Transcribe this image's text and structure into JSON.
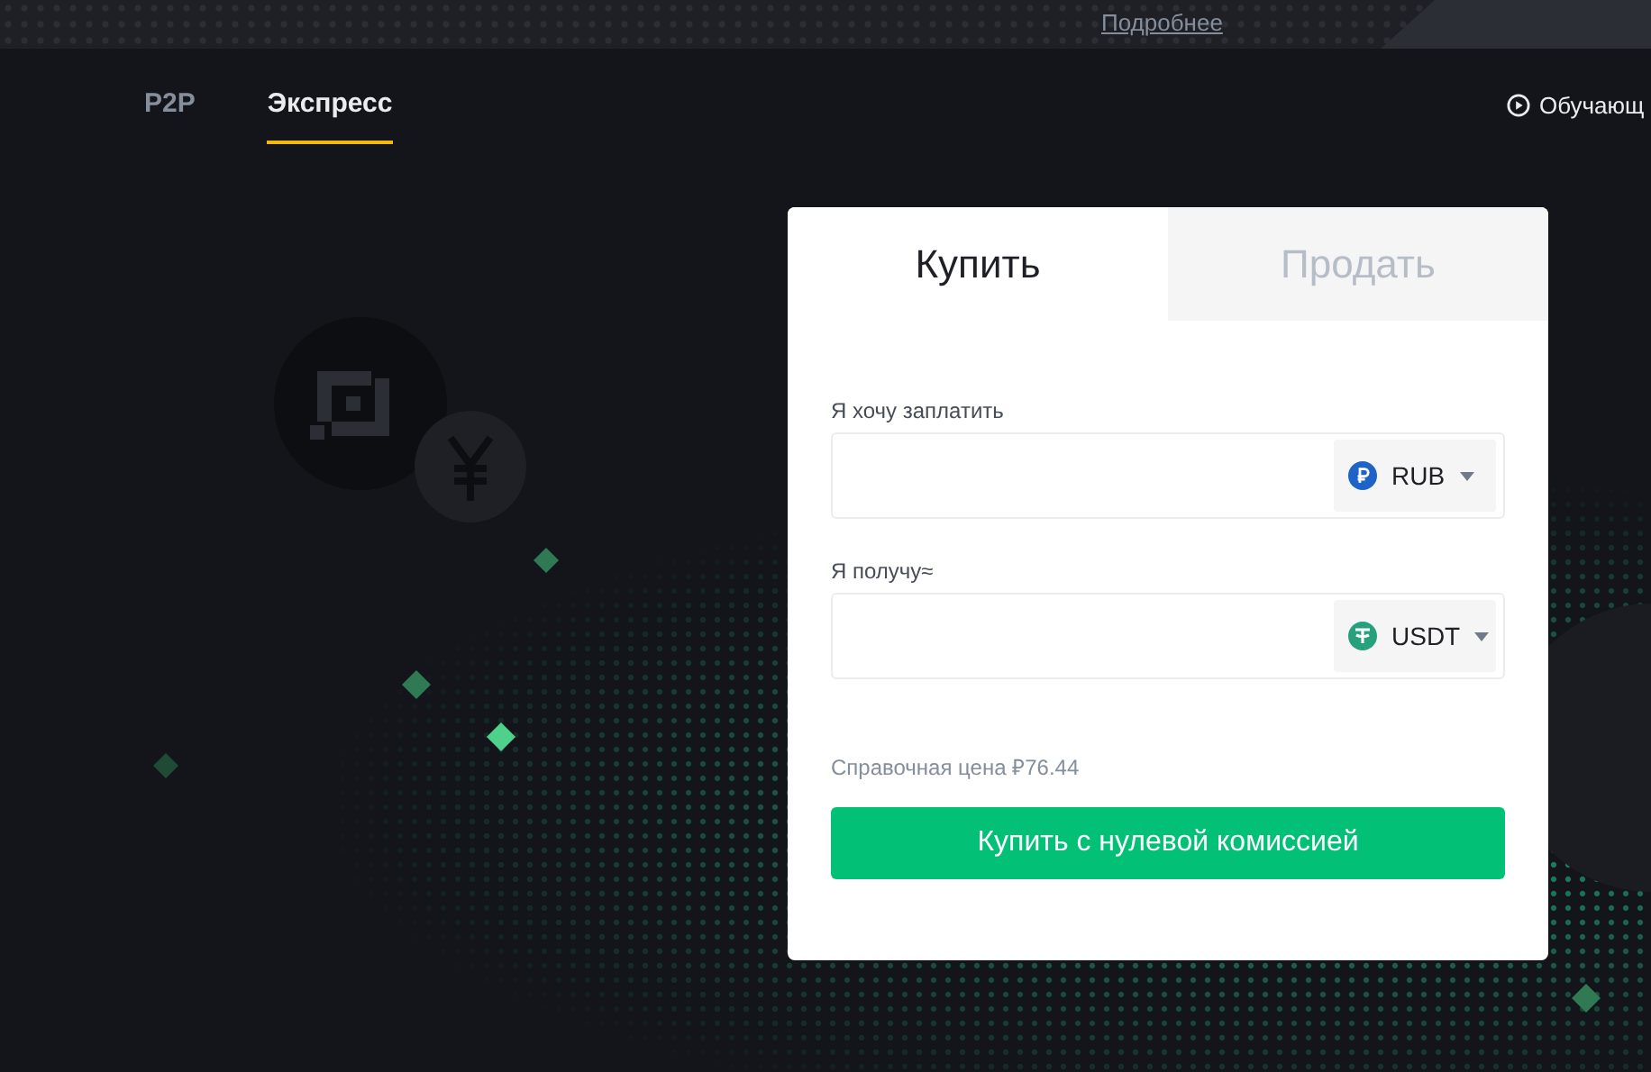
{
  "banner": {
    "link": "Подробнее"
  },
  "nav": {
    "tabs": [
      {
        "label": "P2P",
        "selected": false
      },
      {
        "label": "Экспресс",
        "selected": true
      }
    ],
    "tutorial": "Обучающ"
  },
  "card": {
    "tabs": [
      {
        "label": "Купить",
        "selected": true
      },
      {
        "label": "Продать",
        "selected": false
      }
    ],
    "fields": [
      {
        "label": "Я хочу заплатить",
        "currency": "RUB",
        "kind": "ruble"
      },
      {
        "label": "Я получу≈",
        "currency": "USDT",
        "kind": "tether"
      }
    ],
    "reference_price": "Справочная цена ₽76.44",
    "submit": "Купить с нулевой комиссией"
  }
}
